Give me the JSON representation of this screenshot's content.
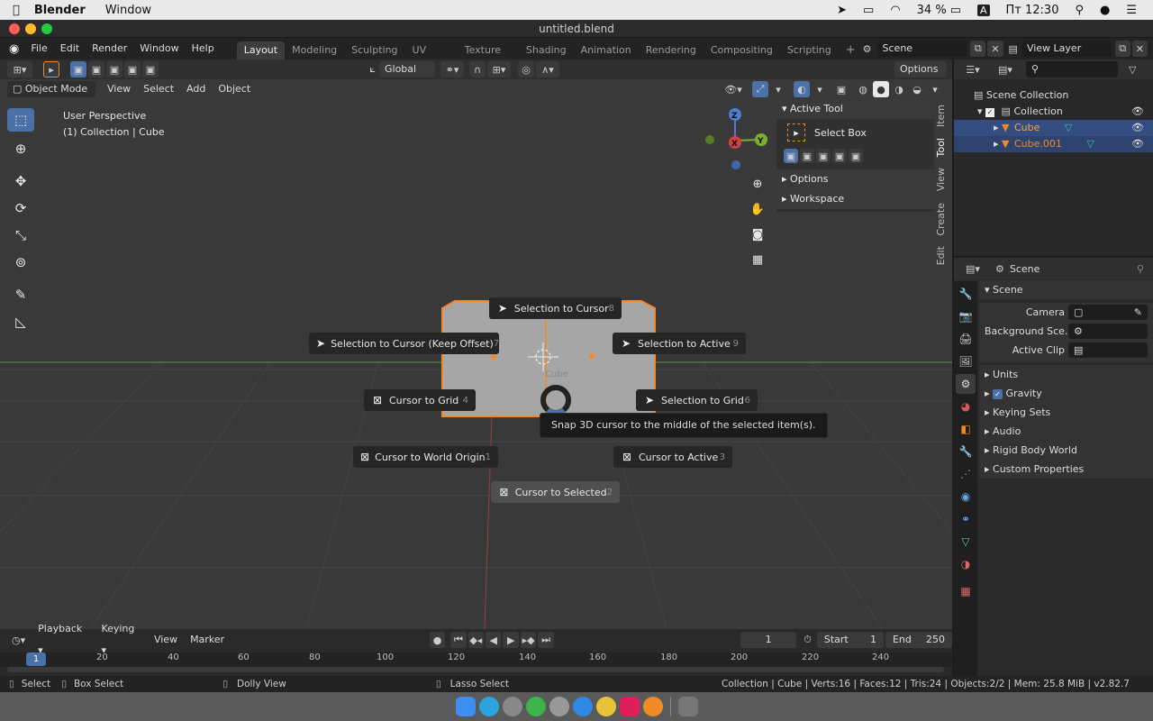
{
  "macos_menubar": {
    "app_name": "Blender",
    "menu_window": "Window",
    "battery": "34 %",
    "clock": "Пт 12:30"
  },
  "window": {
    "title": "untitled.blend"
  },
  "topbar": {
    "menus": [
      "File",
      "Edit",
      "Render",
      "Window",
      "Help"
    ],
    "workspaces": [
      "Layout",
      "Modeling",
      "Sculpting",
      "UV Editing",
      "Texture Paint",
      "Shading",
      "Animation",
      "Rendering",
      "Compositing",
      "Scripting"
    ],
    "active_workspace": "Layout",
    "add_tab": "+",
    "scene_name": "Scene",
    "view_layer": "View Layer"
  },
  "header": {
    "transform_orientation": "Global",
    "options_label": "Options",
    "mode": "Object Mode",
    "menus": [
      "View",
      "Select",
      "Add",
      "Object"
    ]
  },
  "viewport": {
    "info_line1": "User Perspective",
    "info_line2": "(1) Collection | Cube",
    "gizmo": {
      "z": "Z",
      "y": "Y",
      "x": "X"
    },
    "cube_label": "Cube",
    "pie_menu": [
      {
        "label": "Selection to Cursor",
        "key": "8",
        "icon": "arrow-icon"
      },
      {
        "label": "Selection to Cursor (Keep Offset)",
        "key": "7",
        "icon": "arrow-icon"
      },
      {
        "label": "Selection to Active",
        "key": "9",
        "icon": "arrow-icon"
      },
      {
        "label": "Cursor to Grid",
        "key": "4",
        "icon": "cursor-icon"
      },
      {
        "label": "Selection to Grid",
        "key": "6",
        "icon": "arrow-icon"
      },
      {
        "label": "Cursor to World Origin",
        "key": "1",
        "icon": "cursor-icon"
      },
      {
        "label": "Cursor to Active",
        "key": "3",
        "icon": "cursor-icon"
      },
      {
        "label": "Cursor to Selected",
        "key": "2",
        "icon": "cursor-icon",
        "highlighted": true
      }
    ],
    "tooltip": "Snap 3D cursor to the middle of the selected item(s)."
  },
  "npanel": {
    "active_tool_title": "Active Tool",
    "tool_name": "Select Box",
    "options": "Options",
    "workspace": "Workspace",
    "tabs": [
      "Item",
      "Tool",
      "View",
      "Create",
      "Edit"
    ],
    "active_tab": "Tool"
  },
  "outliner": {
    "root": "Scene Collection",
    "collection": "Collection",
    "objects": [
      "Cube",
      "Cube.001"
    ]
  },
  "properties": {
    "context": "Scene",
    "panel_title": "Scene",
    "camera_label": "Camera",
    "background_label": "Background Sce..",
    "active_clip_label": "Active Clip",
    "sections": [
      "Units",
      "Gravity",
      "Keying Sets",
      "Audio",
      "Rigid Body World",
      "Custom Properties"
    ],
    "gravity_checked": true
  },
  "timeline": {
    "menus": [
      "Playback",
      "Keying",
      "View",
      "Marker"
    ],
    "current_frame": "1",
    "start_label": "Start",
    "start_value": "1",
    "end_label": "End",
    "end_value": "250",
    "ruler_ticks": [
      "20",
      "40",
      "60",
      "80",
      "100",
      "120",
      "140",
      "160",
      "180",
      "200",
      "220",
      "240"
    ],
    "ruler_current": "1"
  },
  "statusbar": {
    "select": "Select",
    "box_select": "Box Select",
    "dolly_view": "Dolly View",
    "lasso_select": "Lasso Select",
    "stats": "Collection | Cube | Verts:16 | Faces:12 | Tris:24 | Objects:2/2 | Mem: 25.8 MiB | v2.82.7"
  },
  "colors": {
    "accent": "#4c70a8",
    "selection_orange": "#f08a24",
    "grid": "#393939"
  }
}
